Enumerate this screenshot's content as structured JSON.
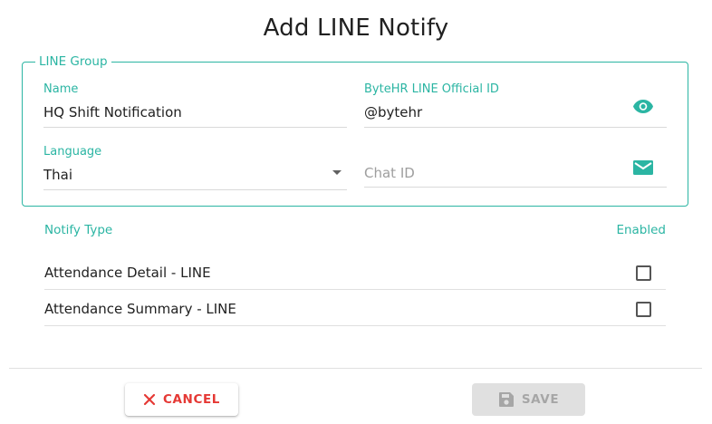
{
  "dialog": {
    "title": "Add LINE Notify"
  },
  "line_group": {
    "legend": "LINE Group",
    "name": {
      "label": "Name",
      "value": "HQ Shift Notification"
    },
    "official_id": {
      "label": "ByteHR LINE Official ID",
      "value": "@bytehr",
      "icon": "eye-icon"
    },
    "language": {
      "label": "Language",
      "value": "Thai"
    },
    "chat_id": {
      "placeholder": "Chat ID",
      "icon": "mail-icon"
    }
  },
  "notify": {
    "type_header": "Notify Type",
    "enabled_header": "Enabled",
    "rows": [
      {
        "label": "Attendance Detail - LINE",
        "enabled": false
      },
      {
        "label": "Attendance Summary - LINE",
        "enabled": false
      }
    ]
  },
  "actions": {
    "cancel_label": "CANCEL",
    "save_label": "SAVE"
  },
  "colors": {
    "accent": "#2bb5a3",
    "danger": "#e53935",
    "disabled_bg": "#e0e0e0",
    "disabled_text": "#a6a6a6"
  }
}
